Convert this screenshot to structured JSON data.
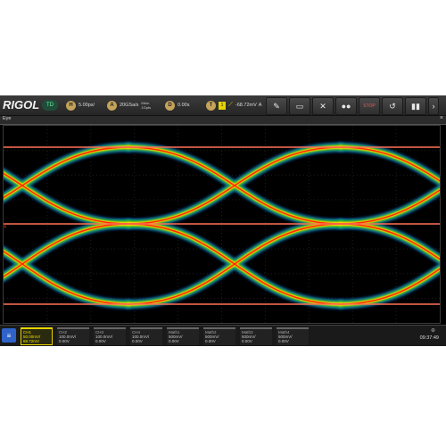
{
  "toolbar": {
    "brand": "RIGOL",
    "mode": "TD",
    "h_icon": "H",
    "timebase": "5.00ps/",
    "a_icon": "A",
    "sample_rate": "20GSa/s",
    "memory_top": "Mem",
    "memory_bottom": "1Gpts",
    "d_icon": "D",
    "delay": "0.00s",
    "t_icon": "T",
    "trig_ch": "1",
    "trig_level": "-68.72mV",
    "trig_suffix": "A",
    "buttons": [
      {
        "name": "measure-button",
        "glyph": "✎"
      },
      {
        "name": "ruler-button",
        "glyph": "▭"
      },
      {
        "name": "cursor-button",
        "glyph": "✕"
      },
      {
        "name": "eye-button",
        "glyph": "●●"
      },
      {
        "name": "stop-button",
        "glyph": "STOP"
      },
      {
        "name": "restore-button",
        "glyph": "↺"
      },
      {
        "name": "page-button",
        "glyph": "▮▮"
      },
      {
        "name": "more-button",
        "glyph": "›"
      }
    ]
  },
  "window": {
    "title": "Eye",
    "close": "×"
  },
  "plot": {
    "marker": "1",
    "colors": {
      "hot": "#ff2a00",
      "mid": "#f5d000",
      "cool": "#23b823",
      "cold": "#0a5bd6"
    }
  },
  "channels": [
    {
      "name": "CH1",
      "scale": "50.00mV/",
      "offset": "68.72mV",
      "active": true
    },
    {
      "name": "CH2",
      "scale": "100.0mV/",
      "offset": "0.00V",
      "active": false
    },
    {
      "name": "CH3",
      "scale": "100.0mV/",
      "offset": "0.00V",
      "active": false
    },
    {
      "name": "CH4",
      "scale": "100.0mV/",
      "offset": "0.00V",
      "active": false
    },
    {
      "name": "Math1",
      "scale": "500mV/",
      "offset": "0.00V",
      "active": false
    },
    {
      "name": "Math2",
      "scale": "500mV/",
      "offset": "0.00V",
      "active": false
    },
    {
      "name": "Math3",
      "scale": "500mV/",
      "offset": "0.00V",
      "active": false
    },
    {
      "name": "Math4",
      "scale": "500mV/",
      "offset": "0.00V",
      "active": false
    }
  ],
  "clock": "09:37:49"
}
